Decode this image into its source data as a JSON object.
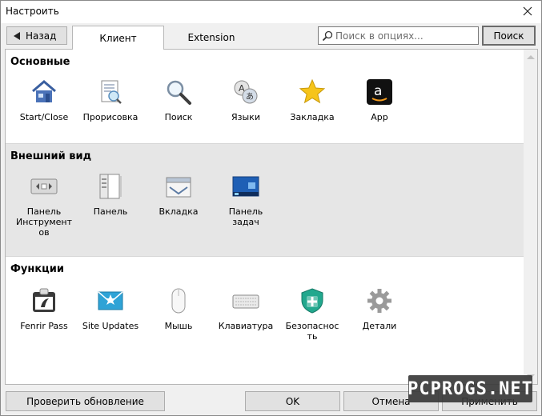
{
  "window": {
    "title": "Настроить"
  },
  "toolbar": {
    "back_label": "Назад",
    "tabs": [
      {
        "label": "Клиент",
        "active": true
      },
      {
        "label": "Extension",
        "active": false
      }
    ],
    "search_placeholder": "Поиск в опциях...",
    "search_button": "Поиск"
  },
  "sections": [
    {
      "title": "Основные",
      "items": [
        {
          "label": "Start/Close",
          "icon": "house-icon"
        },
        {
          "label": "Прорисовка",
          "icon": "render-icon"
        },
        {
          "label": "Поиск",
          "icon": "magnifier-icon"
        },
        {
          "label": "Языки",
          "icon": "languages-icon"
        },
        {
          "label": "Закладка",
          "icon": "star-icon"
        },
        {
          "label": "App",
          "icon": "amazon-icon"
        }
      ]
    },
    {
      "title": "Внешний вид",
      "items": [
        {
          "label": "Панель Инструмент ов",
          "icon": "toolbar-panel-icon"
        },
        {
          "label": "Панель",
          "icon": "panel-icon"
        },
        {
          "label": "Вкладка",
          "icon": "tab-icon"
        },
        {
          "label": "Панель задач",
          "icon": "taskbar-icon"
        }
      ]
    },
    {
      "title": "Функции",
      "items": [
        {
          "label": "Fenrir Pass",
          "icon": "fenrir-pass-icon"
        },
        {
          "label": "Site Updates",
          "icon": "site-updates-icon"
        },
        {
          "label": "Мышь",
          "icon": "mouse-icon"
        },
        {
          "label": "Клавиатура",
          "icon": "keyboard-icon"
        },
        {
          "label": "Безопаснос ть",
          "icon": "shield-icon"
        },
        {
          "label": "Детали",
          "icon": "gear-icon"
        }
      ]
    }
  ],
  "bottom": {
    "update_label": "Проверить обновление",
    "ok_label": "OK",
    "cancel_label": "Отмена",
    "apply_label": "Применить"
  },
  "watermark": "PCPROGS.NET",
  "colors": {
    "accent": "#2b78d6",
    "star": "#f6c41a",
    "shield": "#22a88e"
  }
}
